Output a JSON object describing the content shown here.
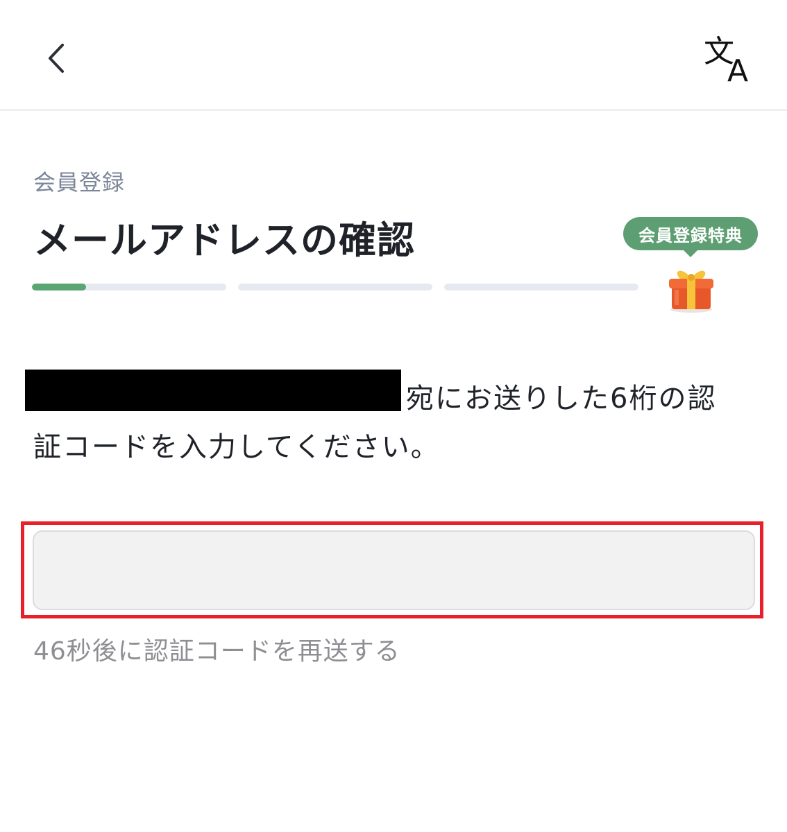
{
  "header": {
    "back_icon": "chevron-left-icon",
    "translate_icon": "translate-icon",
    "translate_glyph_kanji": "文",
    "translate_glyph_latin": "A"
  },
  "main": {
    "section_label": "会員登録",
    "title": "メールアドレスの確認",
    "progress": [
      {
        "step": 1,
        "fill_fraction": 0.28
      },
      {
        "step": 2,
        "fill_fraction": 0
      },
      {
        "step": 3,
        "fill_fraction": 0
      }
    ],
    "bonus_badge": "会員登録特典",
    "gift_icon": "gift-icon",
    "instruction_line1": "宛にお送りした6桁の認",
    "instruction_line2": "証コードを入力してください。",
    "code_input": {
      "value": "",
      "placeholder": ""
    },
    "resend_text": "46秒後に認証コードを再送する"
  },
  "colors": {
    "accent_green": "#5aa673",
    "badge_green": "#5d9f72",
    "highlight_red": "#e8202a",
    "muted_text": "#8e8e93"
  }
}
